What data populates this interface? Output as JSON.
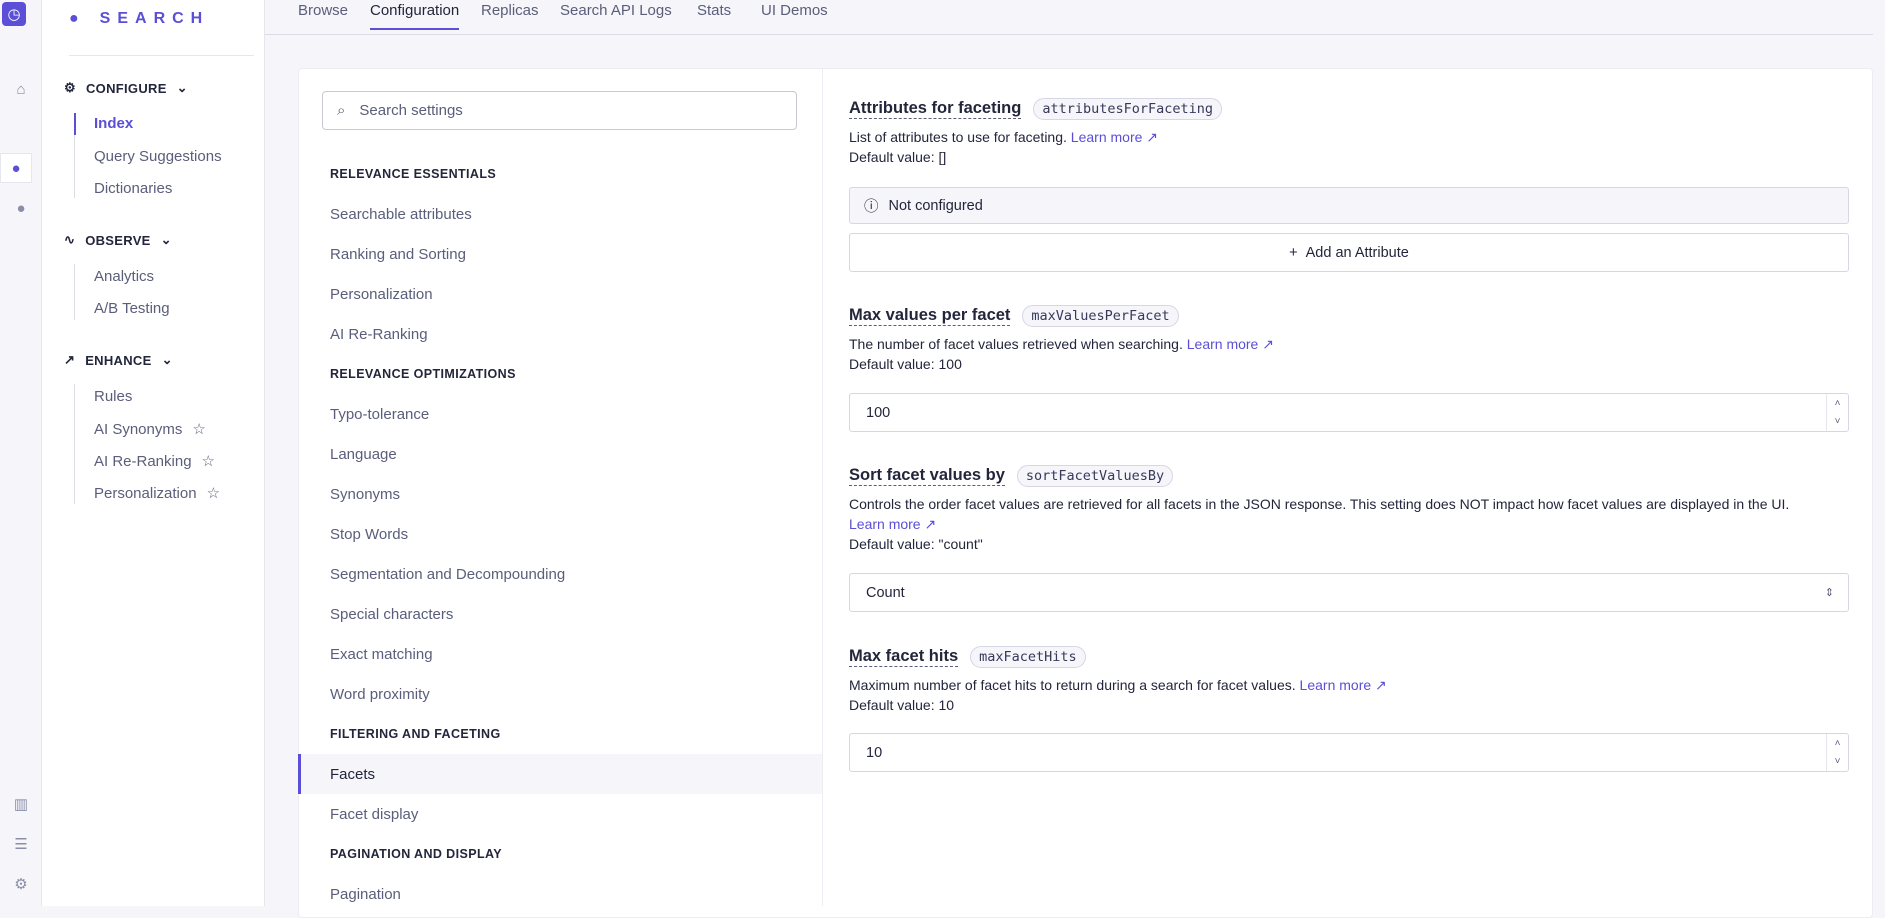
{
  "app": {
    "name": "SEARCH",
    "accent": "#5a4fd6"
  },
  "rail": [
    "logo-icon",
    "home-icon",
    "search-icon",
    "bulb-icon",
    "chart-icon",
    "database-icon",
    "gear-icon"
  ],
  "sidebar": {
    "groups": [
      {
        "label": "CONFIGURE",
        "items": [
          "Index",
          "Query Suggestions",
          "Dictionaries"
        ]
      },
      {
        "label": "OBSERVE",
        "items": [
          "Analytics",
          "A/B Testing"
        ]
      },
      {
        "label": "ENHANCE",
        "items": [
          "Rules",
          "AI Synonyms",
          "AI Re-Ranking",
          "Personalization"
        ]
      }
    ],
    "active": "Index"
  },
  "tabs": [
    "Browse",
    "Configuration",
    "Replicas",
    "Search API Logs",
    "Stats",
    "UI Demos"
  ],
  "active_tab": "Configuration",
  "settings": {
    "search_placeholder": "Search settings",
    "list": [
      "RELEVANCE ESSENTIALS",
      "Searchable attributes",
      "Ranking and Sorting",
      "Personalization",
      "AI Re-Ranking",
      "RELEVANCE OPTIMIZATIONS",
      "Typo-tolerance",
      "Language",
      "Synonyms",
      "Stop Words",
      "Segmentation and Decompounding",
      "Special characters",
      "Exact matching",
      "Word proximity",
      "FILTERING AND FACETING",
      "Facets",
      "Facet display",
      "PAGINATION AND DISPLAY",
      "Pagination"
    ],
    "selected": "Facets"
  },
  "panel": {
    "learn_more": "Learn more",
    "s1": {
      "title": "Attributes for faceting",
      "code": "attributesForFaceting",
      "desc": "List of attributes to use for faceting.",
      "default": "Default value: []",
      "status": "Not configured",
      "add": "Add an Attribute"
    },
    "s2": {
      "title": "Max values per facet",
      "code": "maxValuesPerFacet",
      "desc": "The number of facet values retrieved when searching.",
      "default": "Default value: 100",
      "value": "100"
    },
    "s3": {
      "title": "Sort facet values by",
      "code": "sortFacetValuesBy",
      "desc": "Controls the order facet values are retrieved for all facets in the JSON response. This setting does NOT impact how facet values are displayed in the UI.",
      "default": "Default value: \"count\"",
      "value": "Count"
    },
    "s4": {
      "title": "Max facet hits",
      "code": "maxFacetHits",
      "desc": "Maximum number of facet hits to return during a search for facet values.",
      "default": "Default value: 10",
      "value": "10"
    }
  }
}
